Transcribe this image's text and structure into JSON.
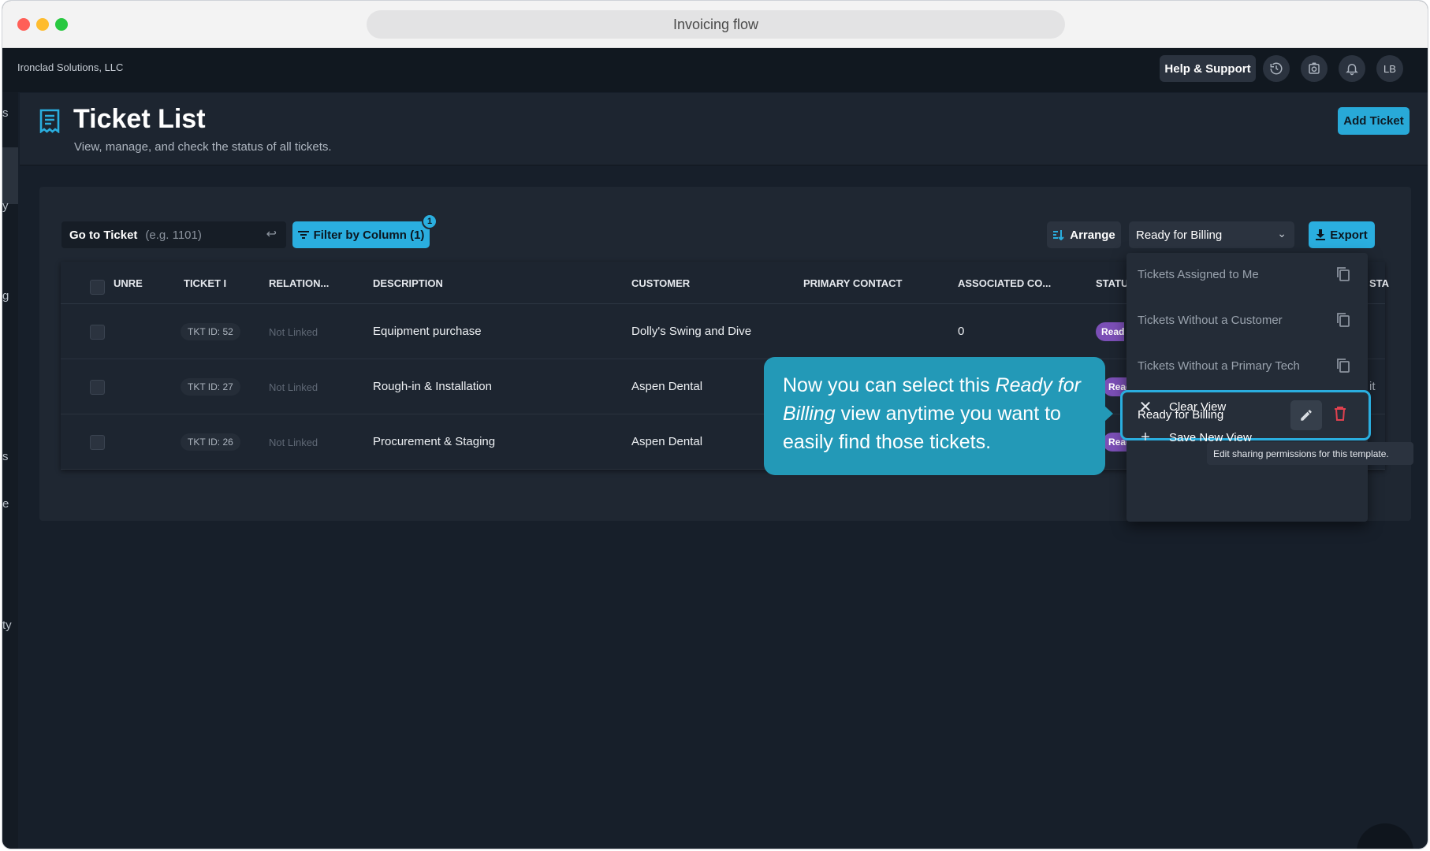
{
  "window": {
    "title": "Invoicing flow"
  },
  "appbar": {
    "org_name": "Ironclad Solutions, LLC",
    "help_label": "Help & Support",
    "avatar_initials": "LB",
    "icons": [
      "history-icon",
      "camera-icon",
      "bell-icon"
    ]
  },
  "sidebar_fragments": [
    "s",
    "y",
    "g",
    "s",
    "e",
    "ty"
  ],
  "header": {
    "title": "Ticket List",
    "subtitle": "View, manage, and check the status of all tickets.",
    "add_ticket_label": "Add Ticket"
  },
  "toolbar": {
    "goto_label": "Go to Ticket",
    "goto_placeholder": "(e.g. 1101)",
    "filter_label": "Filter by Column (1)",
    "filter_badge": "1",
    "arrange_label": "Arrange",
    "view_selected": "Ready for Billing",
    "export_label": "Export"
  },
  "table": {
    "columns": [
      "UNRE",
      "TICKET I",
      "RELATION...",
      "DESCRIPTION",
      "CUSTOMER",
      "PRIMARY CONTACT",
      "ASSOCIATED CO...",
      "STATU",
      "STA"
    ],
    "rows": [
      {
        "ticket_id": "TKT ID: 52",
        "relation": "Not Linked",
        "description": "Equipment purchase",
        "customer": "Dolly's Swing and Dive",
        "primary_contact": "",
        "associated": "0",
        "status": "Ready"
      },
      {
        "ticket_id": "TKT ID: 27",
        "relation": "Not Linked",
        "description": "Rough-in & Installation",
        "customer": "Aspen Dental",
        "primary_contact": "",
        "associated": "",
        "status": "Ready"
      },
      {
        "ticket_id": "TKT ID: 26",
        "relation": "Not Linked",
        "description": "Procurement & Staging",
        "customer": "Aspen Dental",
        "primary_contact": "",
        "associated": "",
        "status": "Ready"
      }
    ],
    "right_edge_text": "it"
  },
  "callout": {
    "text_before": "Now you can select this ",
    "text_em": "Ready for Billing",
    "text_after": " view anytime you want to easily find those tickets."
  },
  "views_dropdown": {
    "items": [
      "Tickets Assigned to Me",
      "Tickets Without a Customer",
      "Tickets Without a Primary Tech"
    ],
    "active": "Ready for Billing",
    "clear_label": "Clear View",
    "save_label": "Save New View"
  },
  "tooltip": "Edit sharing permissions for this template.",
  "colors": {
    "accent": "#2aaedf",
    "callout": "#2399b7",
    "status_pill": "#7b4fb6",
    "delete": "#e0414f"
  }
}
